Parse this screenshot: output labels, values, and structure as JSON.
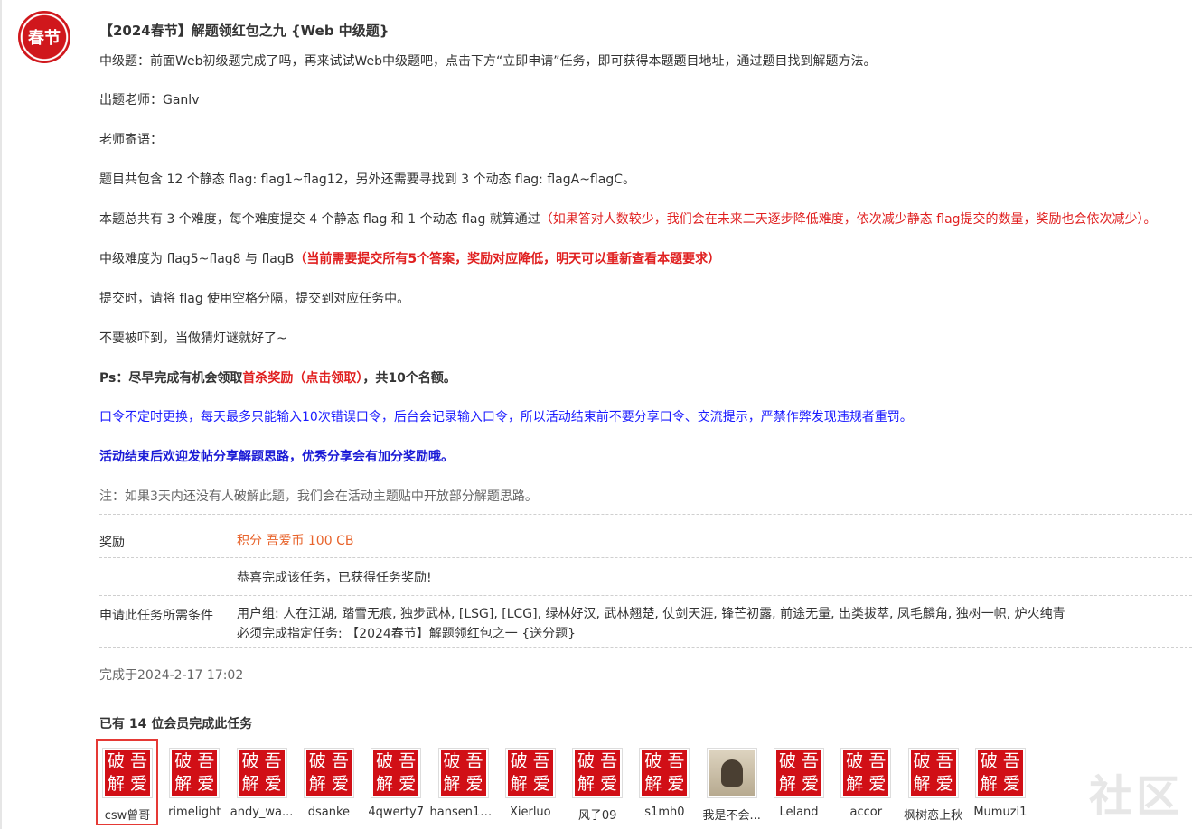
{
  "task": {
    "icon_label": "春节",
    "title": "【2024春节】解题领红包之九 {Web 中级题}",
    "intro": "中级题：前面Web初级题完成了吗，再来试试Web中级题吧，点击下方“立即申请”任务，即可获得本题题目地址，通过题目找到解题方法。",
    "teacher": "出题老师：Ganlv",
    "teacher_note": "老师寄语：",
    "flags_info": "题目共包含 12 个静态 flag: flag1~flag12，另外还需要寻找到 3 个动态 flag: flagA~flagC。",
    "difficulty_info": "本题总共有 3 个难度，每个难度提交 4 个静态 flag 和 1 个动态 flag 就算通过",
    "difficulty_note": "（如果答对人数较少，我们会在未来二天逐步降低难度，依次减少静态 flag提交的数量，奖励也会依次减少）。",
    "medium_info": "中级难度为 flag5~flag8 与 flagB",
    "medium_note": "（当前需要提交所有5个答案，奖励对应降低，明天可以重新查看本题要求）",
    "submit_info": "提交时，请将 flag 使用空格分隔，提交到对应任务中。",
    "encourage": "不要被吓到，当做猜灯谜就好了~",
    "ps_prefix": "Ps：尽早完成有机会领取",
    "ps_link": "首杀奖励（点击领取）",
    "ps_suffix": "，共10个名额。",
    "password_note": "口令不定时更换，每天最多只能输入10次错误口令，后台会记录输入口令，所以活动结束前不要分享口令、交流提示，严禁作弊发现违规者重罚。",
    "share_note": "活动结束后欢迎发帖分享解题思路，优秀分享会有加分奖励哦。",
    "hint_note": "注：如果3天内还没有人破解此题，我们会在活动主题贴中开放部分解题思路。"
  },
  "reward": {
    "label": "奖励",
    "value": "积分 吾爱币 100 CB",
    "congrats": "恭喜完成该任务，已获得任务奖励!"
  },
  "requirements": {
    "label": "申请此任务所需条件",
    "groups": "用户组: 人在江湖, 踏雪无痕, 独步武林, [LSG], [LCG], 绿林好汉, 武林翘楚, 仗剑天涯, 锋芒初露, 前途无量, 出类拔萃, 凤毛麟角, 独树一帜, 炉火纯青",
    "prerequisite": "必须完成指定任务: 【2024春节】解题领红包之一 {送分题}"
  },
  "completed_at": "完成于2024-2-17 17:02",
  "members_title": "已有 14 位会员完成此任务",
  "seal_chars": [
    "破",
    "吾",
    "解",
    "爱"
  ],
  "members": [
    {
      "name": "csw曾哥",
      "avatar": "seal"
    },
    {
      "name": "rimelight",
      "avatar": "seal"
    },
    {
      "name": "andy_wa...",
      "avatar": "seal"
    },
    {
      "name": "dsanke",
      "avatar": "seal"
    },
    {
      "name": "4qwerty7",
      "avatar": "seal"
    },
    {
      "name": "hansen12...",
      "avatar": "seal"
    },
    {
      "name": "Xierluo",
      "avatar": "seal"
    },
    {
      "name": "风子09",
      "avatar": "seal"
    },
    {
      "name": "s1mh0",
      "avatar": "seal"
    },
    {
      "name": "我是不会...",
      "avatar": "photo"
    },
    {
      "name": "Leland",
      "avatar": "seal"
    },
    {
      "name": "accor",
      "avatar": "seal"
    },
    {
      "name": "枫树恋上秋",
      "avatar": "seal"
    },
    {
      "name": "Mumuzi1",
      "avatar": "seal"
    }
  ],
  "watermark": "社区",
  "colors": {
    "accent_red": "#e02020",
    "link_blue": "#1a1aff",
    "reward_orange": "#e8642c"
  }
}
